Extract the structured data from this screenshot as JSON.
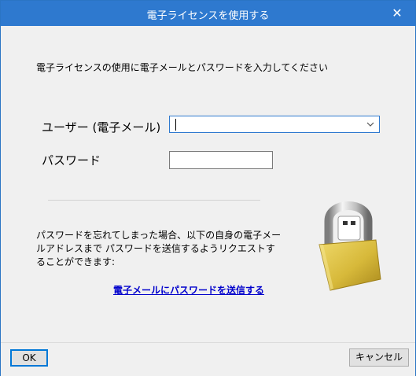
{
  "window": {
    "title": "電子ライセンスを使用する",
    "close_glyph": "✕"
  },
  "form": {
    "instruction": "電子ライセンスの使用に電子メールとパスワードを入力してください",
    "user_label": "ユーザー (電子メール)",
    "user_value": "",
    "password_label": "パスワード",
    "password_value": ""
  },
  "forgot": {
    "text": "パスワードを忘れてしまった場合、以下の自身の電子メールアドレスまで パスワードを送信するようリクエストすることができます:",
    "link": "電子メールにパスワードを送信する"
  },
  "footer": {
    "ok_label": "OK",
    "cancel_label": "キャンセル"
  },
  "colors": {
    "titlebar": "#2e79cf",
    "link": "#0000cc",
    "focus_border": "#0078d7",
    "lock_body": "#d7b93a"
  },
  "icons": {
    "lock": "padlock-icon"
  }
}
